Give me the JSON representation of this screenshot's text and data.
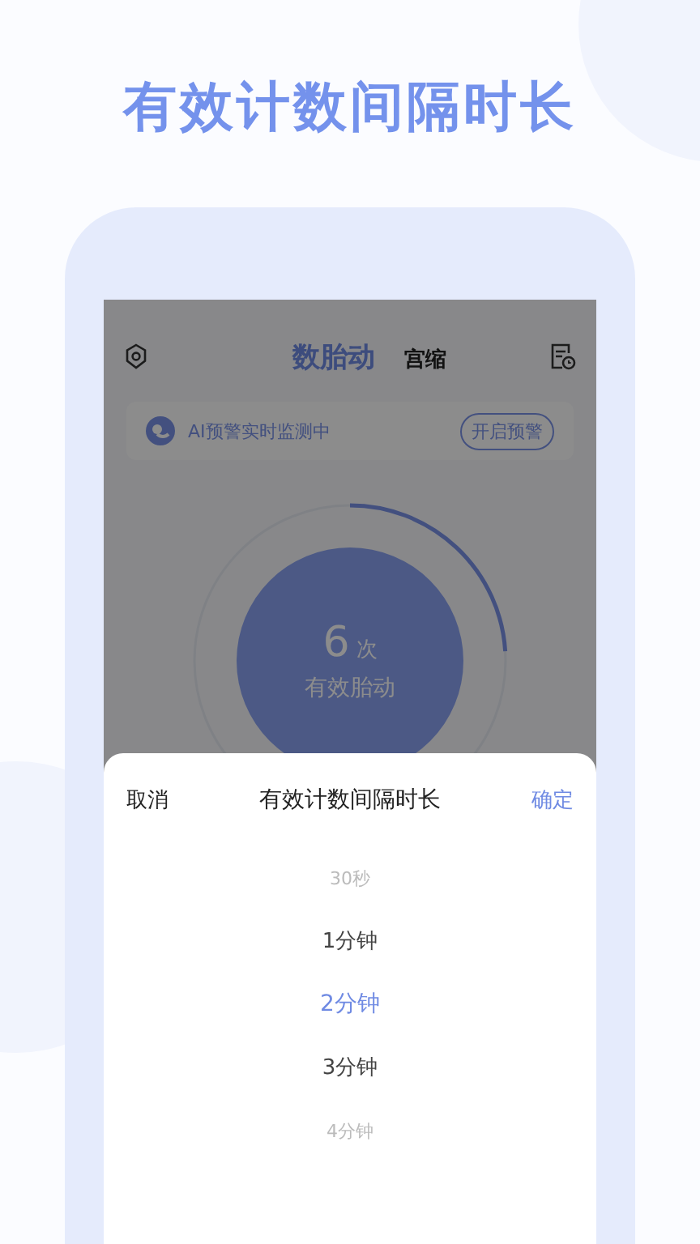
{
  "headline": "有效计数间隔时长",
  "header": {
    "tabs": [
      {
        "label": "数胎动",
        "selected": true
      },
      {
        "label": "宫缩",
        "selected": false
      }
    ]
  },
  "alert_banner": {
    "text": "AI预警实时监测中",
    "button": "开启预警"
  },
  "counter": {
    "count": "6",
    "unit": "次",
    "label": "有效胎动",
    "level": 0.24
  },
  "picker_sheet": {
    "cancel": "取消",
    "title": "有效计数间隔时长",
    "confirm": "确定",
    "options": [
      {
        "label": "30秒",
        "selected": false
      },
      {
        "label": "1分钟",
        "selected": false
      },
      {
        "label": "2分钟",
        "selected": true
      },
      {
        "label": "3分钟",
        "selected": false
      },
      {
        "label": "4分钟",
        "selected": false
      }
    ]
  }
}
